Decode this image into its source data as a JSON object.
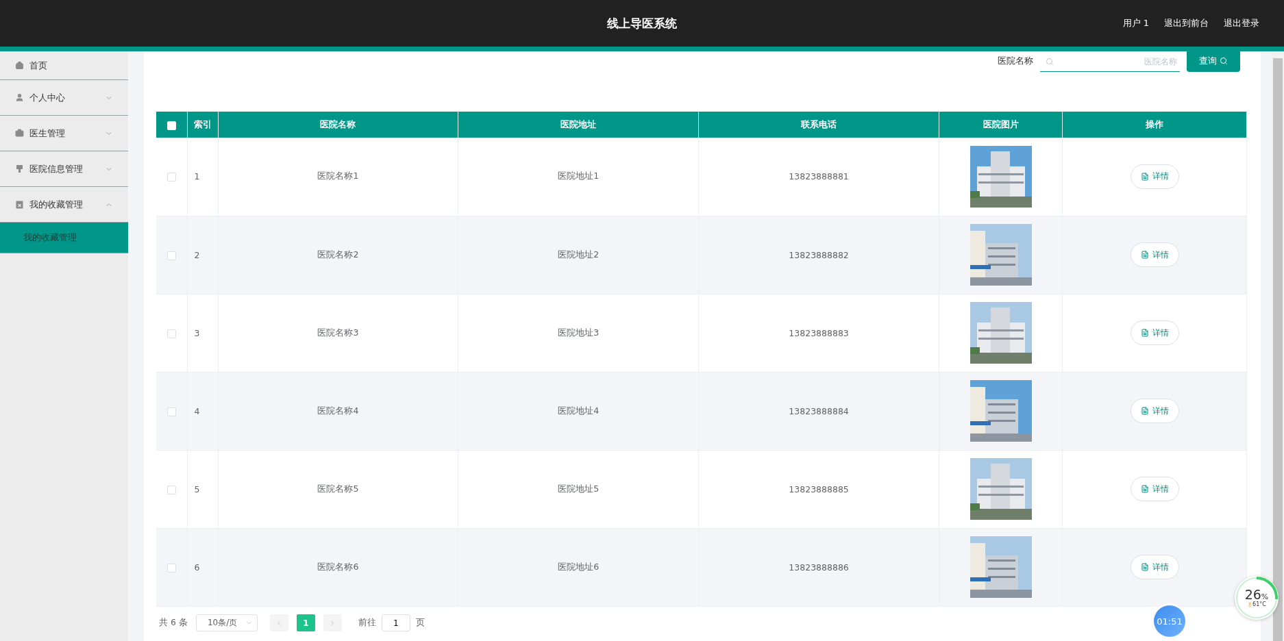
{
  "header": {
    "title": "线上导医系统",
    "links": [
      "用户 1",
      "退出到前台",
      "退出登录"
    ]
  },
  "sidebar": {
    "items": [
      {
        "label": "首页",
        "kind": "link"
      },
      {
        "label": "个人中心",
        "kind": "menu",
        "expanded": false
      },
      {
        "label": "医生管理",
        "kind": "menu",
        "expanded": false
      },
      {
        "label": "医院信息管理",
        "kind": "menu",
        "expanded": false
      },
      {
        "label": "我的收藏管理",
        "kind": "menu",
        "expanded": true,
        "children": [
          {
            "label": "我的收藏管理",
            "selected": true
          }
        ]
      }
    ]
  },
  "search": {
    "label": "医院名称",
    "placeholder": "医院名称",
    "button": "查询"
  },
  "table": {
    "select_all": {
      "checked": false
    },
    "columns": [
      "索引",
      "医院名称",
      "医院地址",
      "联系电话",
      "医院图片",
      "操作"
    ],
    "rows": [
      {
        "checked": false,
        "index": "1",
        "name": "医院名称1",
        "address": "医院地址1",
        "phone": "13823888881",
        "action": "详情"
      },
      {
        "checked": false,
        "index": "2",
        "name": "医院名称2",
        "address": "医院地址2",
        "phone": "13823888882",
        "action": "详情"
      },
      {
        "checked": false,
        "index": "3",
        "name": "医院名称3",
        "address": "医院地址3",
        "phone": "13823888883",
        "action": "详情"
      },
      {
        "checked": false,
        "index": "4",
        "name": "医院名称4",
        "address": "医院地址4",
        "phone": "13823888884",
        "action": "详情"
      },
      {
        "checked": false,
        "index": "5",
        "name": "医院名称5",
        "address": "医院地址5",
        "phone": "13823888885",
        "action": "详情"
      },
      {
        "checked": false,
        "index": "6",
        "name": "医院名称6",
        "address": "医院地址6",
        "phone": "13823888886",
        "action": "详情"
      }
    ]
  },
  "pagination": {
    "total": "共 6 条",
    "page_size": "10条/页",
    "pages": [
      {
        "label": "1",
        "selected": true
      }
    ],
    "goto_label": "前往",
    "goto_value": "1",
    "goto_suffix": "页"
  },
  "overlays": {
    "timer": "01:51",
    "monitor": {
      "value": "26",
      "unit": "%",
      "temperature": "61°C"
    }
  }
}
